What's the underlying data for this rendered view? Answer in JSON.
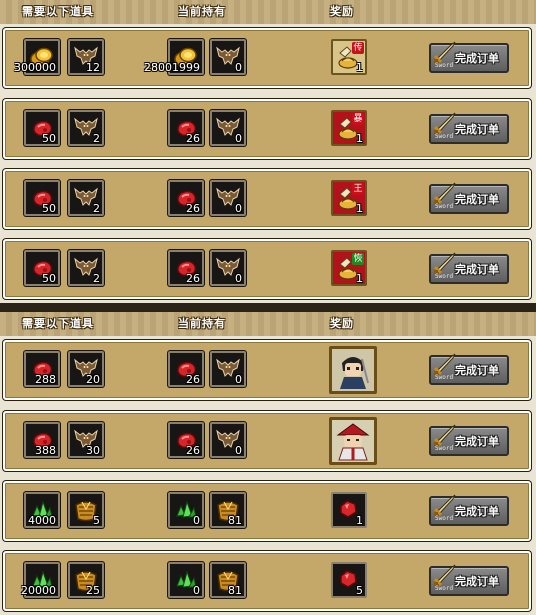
{
  "headers": {
    "required": "需要以下道具",
    "owned": "当前持有",
    "reward": "奖励"
  },
  "button": {
    "label": "完成订单",
    "sub": "Sword"
  },
  "panels": [
    {
      "rows": [
        {
          "req": [
            {
              "icon": "gold-coin-icon",
              "qty": "300000"
            },
            {
              "icon": "bat-icon",
              "qty": "12"
            }
          ],
          "own": [
            {
              "icon": "gold-coin-icon",
              "qty": "28001999"
            },
            {
              "icon": "bat-icon",
              "qty": "0"
            }
          ],
          "reward": {
            "style": "gold",
            "icon": "scroll-bag-icon",
            "tag": "传",
            "qty": "1"
          }
        },
        {
          "req": [
            {
              "icon": "red-ore-icon",
              "qty": "50"
            },
            {
              "icon": "bat-icon",
              "qty": "2"
            }
          ],
          "own": [
            {
              "icon": "red-ore-icon",
              "qty": "26"
            },
            {
              "icon": "bat-icon",
              "qty": "0"
            }
          ],
          "reward": {
            "style": "red",
            "icon": "scroll-bag-icon",
            "tag": "暴",
            "qty": "1"
          }
        },
        {
          "req": [
            {
              "icon": "red-ore-icon",
              "qty": "50"
            },
            {
              "icon": "bat-icon",
              "qty": "2"
            }
          ],
          "own": [
            {
              "icon": "red-ore-icon",
              "qty": "26"
            },
            {
              "icon": "bat-icon",
              "qty": "0"
            }
          ],
          "reward": {
            "style": "red",
            "icon": "scroll-bag-icon",
            "tag": "王",
            "qty": "1"
          }
        },
        {
          "req": [
            {
              "icon": "red-ore-icon",
              "qty": "50"
            },
            {
              "icon": "bat-icon",
              "qty": "2"
            }
          ],
          "own": [
            {
              "icon": "red-ore-icon",
              "qty": "26"
            },
            {
              "icon": "bat-icon",
              "qty": "0"
            }
          ],
          "reward": {
            "style": "red",
            "icon": "scroll-bag-icon",
            "tag": "恢",
            "tagColor": "green",
            "qty": "1"
          }
        }
      ]
    },
    {
      "rows": [
        {
          "req": [
            {
              "icon": "red-ore-icon",
              "qty": "288"
            },
            {
              "icon": "bat-icon",
              "qty": "20"
            }
          ],
          "own": [
            {
              "icon": "red-ore-icon",
              "qty": "26"
            },
            {
              "icon": "bat-icon",
              "qty": "0"
            }
          ],
          "reward": {
            "style": "portrait",
            "icon": "swordsman-portrait-icon",
            "qty": ""
          }
        },
        {
          "req": [
            {
              "icon": "red-ore-icon",
              "qty": "388"
            },
            {
              "icon": "bat-icon",
              "qty": "30"
            }
          ],
          "own": [
            {
              "icon": "red-ore-icon",
              "qty": "26"
            },
            {
              "icon": "bat-icon",
              "qty": "0"
            }
          ],
          "reward": {
            "style": "portrait",
            "icon": "hat-warrior-portrait-icon",
            "qty": ""
          }
        },
        {
          "req": [
            {
              "icon": "green-crystal-icon",
              "qty": "4000"
            },
            {
              "icon": "golden-armor-icon",
              "qty": "5"
            }
          ],
          "own": [
            {
              "icon": "green-crystal-icon",
              "qty": "0"
            },
            {
              "icon": "golden-armor-icon",
              "qty": "81"
            }
          ],
          "reward": {
            "style": "dark",
            "icon": "red-gem-icon",
            "qty": "1"
          }
        },
        {
          "req": [
            {
              "icon": "green-crystal-icon",
              "qty": "20000"
            },
            {
              "icon": "golden-armor-icon",
              "qty": "25"
            }
          ],
          "own": [
            {
              "icon": "green-crystal-icon",
              "qty": "0"
            },
            {
              "icon": "golden-armor-icon",
              "qty": "81"
            }
          ],
          "reward": {
            "style": "dark",
            "icon": "red-gem-icon",
            "qty": "5"
          }
        }
      ]
    }
  ]
}
